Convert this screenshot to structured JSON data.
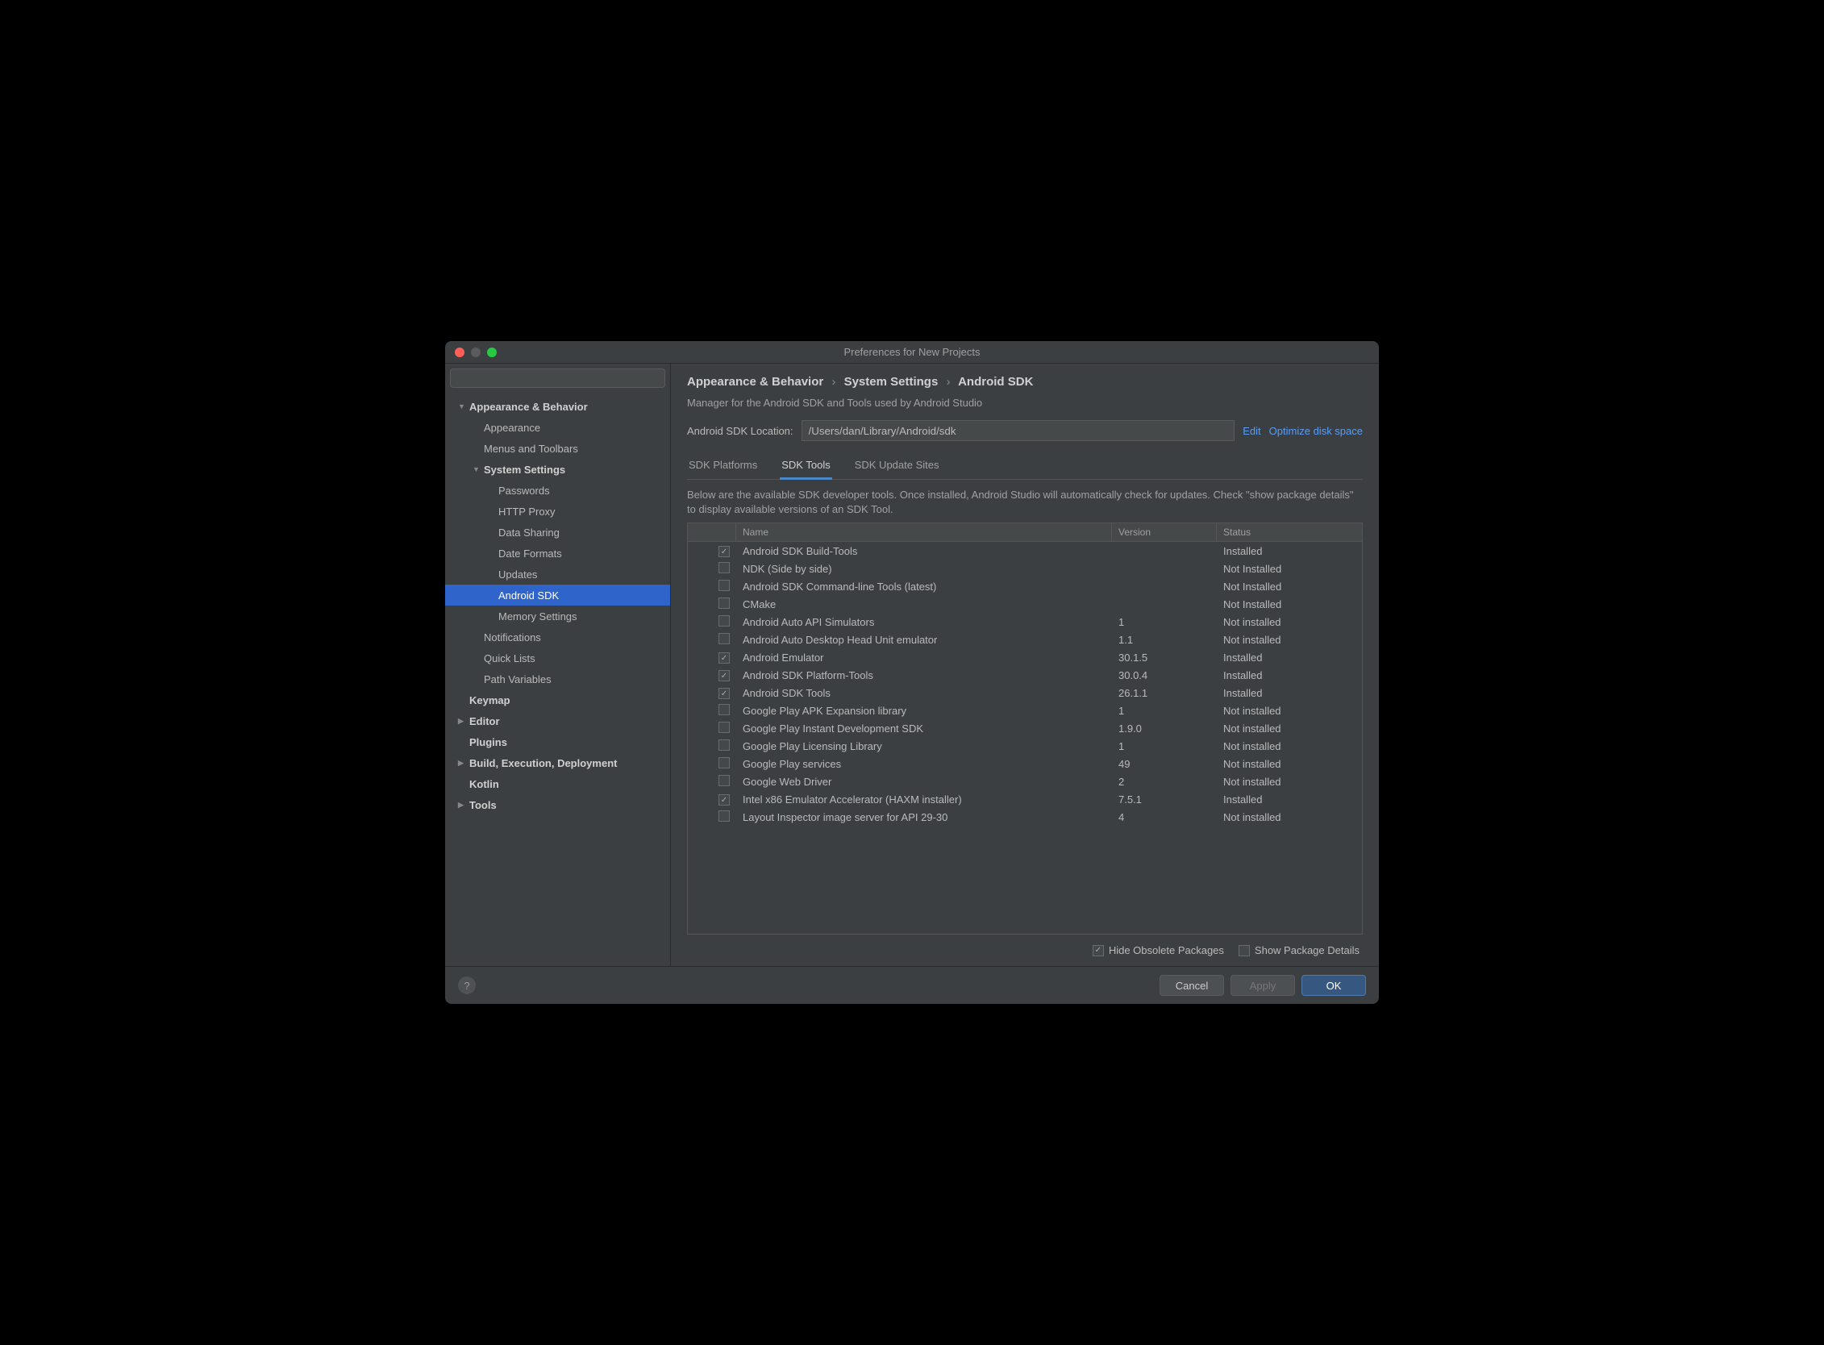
{
  "window": {
    "title": "Preferences for New Projects"
  },
  "search": {
    "placeholder": ""
  },
  "sidebar": {
    "items": [
      {
        "label": "Appearance & Behavior",
        "bold": true,
        "arrow": "down",
        "indent": 0
      },
      {
        "label": "Appearance",
        "indent": 1
      },
      {
        "label": "Menus and Toolbars",
        "indent": 1
      },
      {
        "label": "System Settings",
        "bold": true,
        "arrow": "down",
        "indent": 1
      },
      {
        "label": "Passwords",
        "indent": 2
      },
      {
        "label": "HTTP Proxy",
        "indent": 2
      },
      {
        "label": "Data Sharing",
        "indent": 2
      },
      {
        "label": "Date Formats",
        "indent": 2
      },
      {
        "label": "Updates",
        "indent": 2
      },
      {
        "label": "Android SDK",
        "indent": 2,
        "selected": true
      },
      {
        "label": "Memory Settings",
        "indent": 2
      },
      {
        "label": "Notifications",
        "indent": 1
      },
      {
        "label": "Quick Lists",
        "indent": 1
      },
      {
        "label": "Path Variables",
        "indent": 1
      },
      {
        "label": "Keymap",
        "bold": true,
        "indent": 0
      },
      {
        "label": "Editor",
        "bold": true,
        "arrow": "right",
        "indent": 0
      },
      {
        "label": "Plugins",
        "bold": true,
        "indent": 0
      },
      {
        "label": "Build, Execution, Deployment",
        "bold": true,
        "arrow": "right",
        "indent": 0
      },
      {
        "label": "Kotlin",
        "bold": true,
        "indent": 0
      },
      {
        "label": "Tools",
        "bold": true,
        "arrow": "right",
        "indent": 0
      }
    ]
  },
  "breadcrumb": {
    "parts": [
      "Appearance & Behavior",
      "System Settings",
      "Android SDK"
    ]
  },
  "subtitle": "Manager for the Android SDK and Tools used by Android Studio",
  "location": {
    "label": "Android SDK Location:",
    "value": "/Users/dan/Library/Android/sdk",
    "edit": "Edit",
    "optimize": "Optimize disk space"
  },
  "tabs": [
    {
      "label": "SDK Platforms"
    },
    {
      "label": "SDK Tools",
      "active": true
    },
    {
      "label": "SDK Update Sites"
    }
  ],
  "description": "Below are the available SDK developer tools. Once installed, Android Studio will automatically check for updates. Check \"show package details\" to display available versions of an SDK Tool.",
  "table": {
    "headers": {
      "name": "Name",
      "version": "Version",
      "status": "Status"
    },
    "rows": [
      {
        "checked": true,
        "name": "Android SDK Build-Tools",
        "version": "",
        "status": "Installed"
      },
      {
        "checked": false,
        "name": "NDK (Side by side)",
        "version": "",
        "status": "Not Installed"
      },
      {
        "checked": false,
        "name": "Android SDK Command-line Tools (latest)",
        "version": "",
        "status": "Not Installed"
      },
      {
        "checked": false,
        "name": "CMake",
        "version": "",
        "status": "Not Installed"
      },
      {
        "checked": false,
        "name": "Android Auto API Simulators",
        "version": "1",
        "status": "Not installed"
      },
      {
        "checked": false,
        "name": "Android Auto Desktop Head Unit emulator",
        "version": "1.1",
        "status": "Not installed"
      },
      {
        "checked": true,
        "name": "Android Emulator",
        "version": "30.1.5",
        "status": "Installed"
      },
      {
        "checked": true,
        "name": "Android SDK Platform-Tools",
        "version": "30.0.4",
        "status": "Installed"
      },
      {
        "checked": true,
        "name": "Android SDK Tools",
        "version": "26.1.1",
        "status": "Installed"
      },
      {
        "checked": false,
        "name": "Google Play APK Expansion library",
        "version": "1",
        "status": "Not installed"
      },
      {
        "checked": false,
        "name": "Google Play Instant Development SDK",
        "version": "1.9.0",
        "status": "Not installed"
      },
      {
        "checked": false,
        "name": "Google Play Licensing Library",
        "version": "1",
        "status": "Not installed"
      },
      {
        "checked": false,
        "name": "Google Play services",
        "version": "49",
        "status": "Not installed"
      },
      {
        "checked": false,
        "name": "Google Web Driver",
        "version": "2",
        "status": "Not installed"
      },
      {
        "checked": true,
        "name": "Intel x86 Emulator Accelerator (HAXM installer)",
        "version": "7.5.1",
        "status": "Installed"
      },
      {
        "checked": false,
        "name": "Layout Inspector image server for API 29-30",
        "version": "4",
        "status": "Not installed"
      }
    ]
  },
  "options": {
    "hide_obsolete": {
      "label": "Hide Obsolete Packages",
      "checked": true
    },
    "show_details": {
      "label": "Show Package Details",
      "checked": false
    }
  },
  "buttons": {
    "cancel": "Cancel",
    "apply": "Apply",
    "ok": "OK"
  }
}
